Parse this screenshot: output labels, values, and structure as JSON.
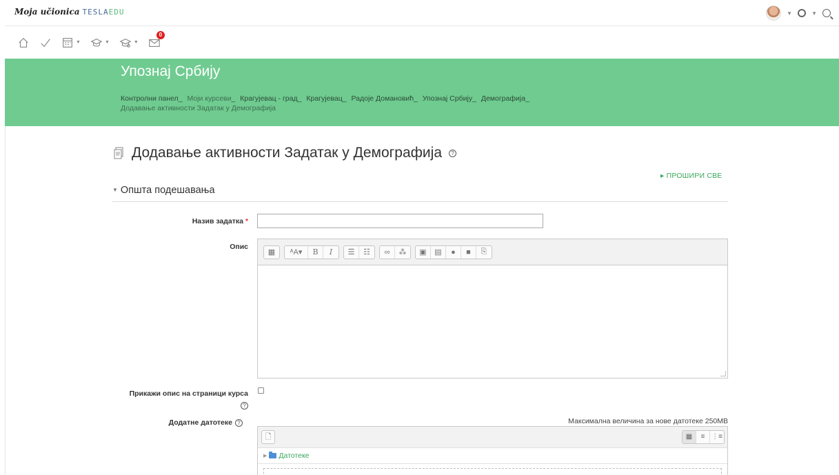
{
  "brand": {
    "name": "Moja učionica",
    "edu_part1": "TESLA",
    "edu_part2": "EDU"
  },
  "topbar": {
    "avatar_alt": "user avatar"
  },
  "iconbar": {
    "messages_count": "0"
  },
  "course": {
    "title": "Упознај Србију",
    "breadcrumb": [
      "Контролни панел",
      "Моји курсеви",
      "Крагујевац - град",
      "Крагујевац",
      "Радоје Домановић",
      "Упознај Србију",
      "Демографија",
      "Додавање активности Задатак у Демографија"
    ]
  },
  "page": {
    "heading": "Додавање активности Задатак у Демографија",
    "expand_all": "ПРОШИРИ СВЕ",
    "section_title": "Општа подешавања"
  },
  "form": {
    "name_label": "Назив задатка",
    "required_mark": "*",
    "name_value": "",
    "description_label": "Опис",
    "show_description_label_line1": "Прикажи опис на страници курса",
    "attachments_label": "Додатне датотеке",
    "max_size": "Максимална величина за нове датотеке 250MB",
    "files_folder": "Датотеке"
  },
  "colors": {
    "header_green": "#6fcb90",
    "link_green": "#39a85c",
    "badge_red": "#e02020"
  }
}
